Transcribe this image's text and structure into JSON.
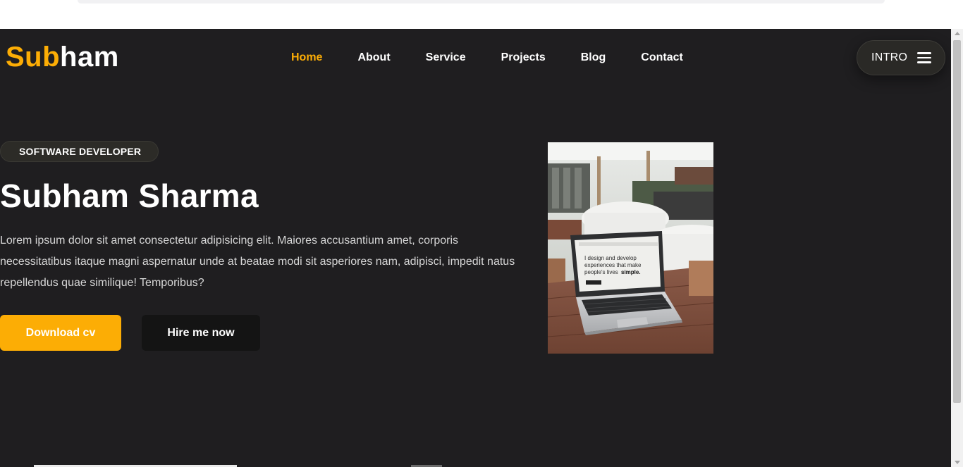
{
  "header": {
    "logo_part1": "Sub",
    "logo_part2": "ham",
    "nav": [
      {
        "label": "Home",
        "active": true
      },
      {
        "label": "About"
      },
      {
        "label": "Service"
      },
      {
        "label": "Projects"
      },
      {
        "label": "Blog"
      },
      {
        "label": "Contact"
      }
    ],
    "intro_label": "INTRO"
  },
  "hero": {
    "badge": "SOFTWARE DEVELOPER",
    "name": "Subham Sharma",
    "description": "Lorem ipsum dolor sit amet consectetur adipisicing elit. Maiores accusantium amet, corporis necessitatibus itaque magni aspernatur unde at beatae modi sit asperiores nam, adipisci, impedit natus repellendus quae similique! Temporibus?",
    "download_label": "Download cv",
    "hire_label": "Hire me now"
  },
  "photo": {
    "screen_line1": "I design and develop",
    "screen_line2": "experiences that make",
    "screen_line3": "people's lives",
    "screen_emphasis": "simple."
  },
  "colors": {
    "accent": "#fcad05",
    "background": "#1f1e20",
    "text": "#ffffff",
    "dark_button": "#141414"
  }
}
